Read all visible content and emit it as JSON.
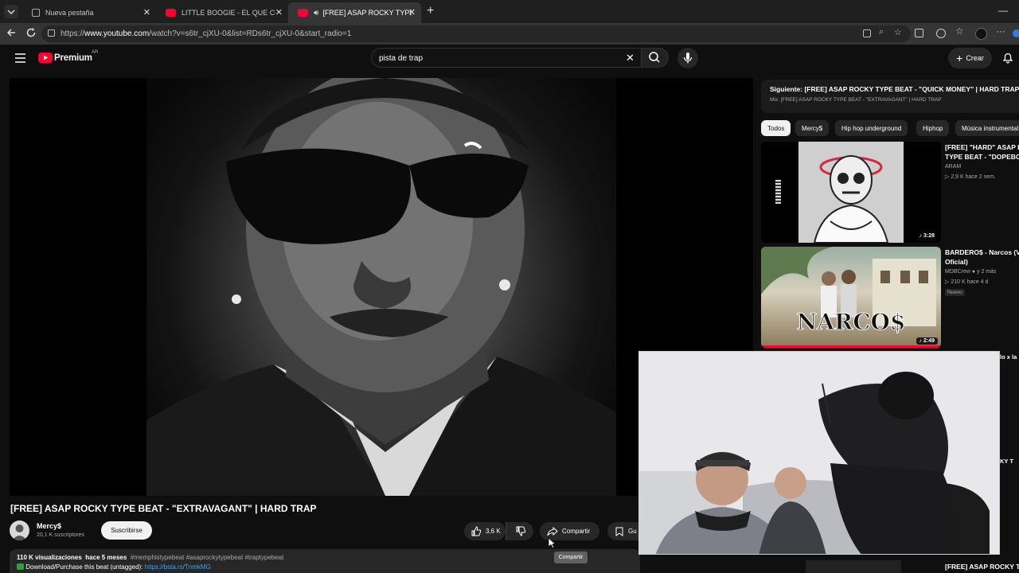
{
  "browser": {
    "tabs": [
      {
        "title": "Nueva pestaña"
      },
      {
        "title": "LITTLE BOOGIE - EL QUE COMPRA"
      },
      {
        "title": "[FREE] ASAP ROCKY TYPE BEAT"
      }
    ],
    "url_prefix": "https://",
    "url_domain": "www.youtube.com",
    "url_rest": "/watch?v=s6tr_cjXU-0&list=RDs6tr_cjXU-0&start_radio=1"
  },
  "header": {
    "logo_text": "Premium",
    "region": "AR",
    "search_value": "pista de trap",
    "create_label": "Crear"
  },
  "video": {
    "title": "[FREE] ASAP ROCKY TYPE BEAT - \"EXTRAVAGANT\" | HARD TRAP",
    "channel_name": "Mercy$",
    "subscribers": "20,1 K suscriptores",
    "subscribe_label": "Suscribirse",
    "likes": "3,6 K",
    "share_label": "Compartir",
    "save_label": "Gu",
    "views": "110 K visualizaciones",
    "age": "hace 5 meses",
    "tags": "#memphistypebeat #asaprockytypebeat #traptypebeat",
    "download_text": "Download/Purchase this beat (untagged): ",
    "download_link": "https://bsta.rs/TnmkMG",
    "tooltip": "Compartir"
  },
  "sidebar": {
    "next_title": "Siguiente: [FREE] ASAP ROCKY TYPE BEAT - \"QUICK MONEY\" | HARD TRAP",
    "next_mix": "Mix: [FREE] ASAP ROCKY TYPE BEAT - \"EXTRAVAGANT\" | HARD TRAP",
    "chips": [
      "Todos",
      "Mercy$",
      "Hip hop underground",
      "Hiphop",
      "Música instrumental"
    ],
    "items": [
      {
        "title_line1": "[FREE] \"HARD\" ASAP ROCKY",
        "title_line2": "TYPE BEAT - \"DOPEBOY\"",
        "channel": "ARAM",
        "stats": "2,9 K  hace 2 sem.",
        "duration": "3:28"
      },
      {
        "title_line1": "BARDERO$ - Narcos (Video",
        "title_line2": "Oficial)",
        "channel": "MDBCrew",
        "stats": "210 K  hace 4 d",
        "extra": "y 2 más",
        "badge": "Nuevo",
        "duration": "2:49"
      }
    ],
    "peek_1": "lo x la",
    "peek_2": "KY T",
    "peek_3": "[FREE] ASAP ROCKY TY"
  },
  "colors": {
    "background": "#0f0f0f",
    "youtube_red": "#ff0033",
    "link_blue": "#3ea6ff"
  }
}
